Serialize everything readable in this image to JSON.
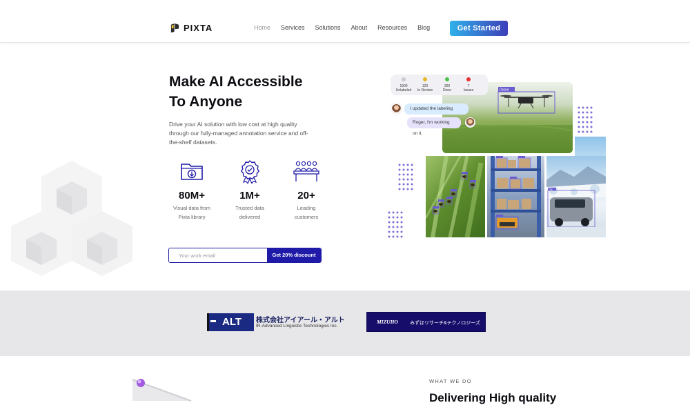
{
  "header": {
    "logo_text": "PIXTA",
    "nav": [
      {
        "label": "Home",
        "active": true
      },
      {
        "label": "Services",
        "active": false
      },
      {
        "label": "Solutions",
        "active": false
      },
      {
        "label": "About",
        "active": false
      },
      {
        "label": "Resources",
        "active": false
      },
      {
        "label": "Blog",
        "active": false
      }
    ],
    "cta_label": "Get Started"
  },
  "hero": {
    "title_line1": "Make AI Accessible",
    "title_line2": "To Anyone",
    "description": "Drive your AI solution with low cost at high quality through our fully-managed annotation service and off-the-shelf datasets.",
    "stats": [
      {
        "value": "80M+",
        "label_line1": "Visual data from",
        "label_line2": "Pixta library",
        "icon": "folder-download-icon"
      },
      {
        "value": "1M+",
        "label_line1": "Trusted data",
        "label_line2": "delivered",
        "icon": "award-badge-icon"
      },
      {
        "value": "20+",
        "label_line1": "Leading",
        "label_line2": "customers",
        "icon": "team-meeting-icon"
      }
    ],
    "email_placeholder": "Your work email",
    "discount_button": "Get 20% discount"
  },
  "collage": {
    "status": [
      {
        "count": "1500",
        "label": "Unlabeled",
        "color": "#c9c9cf"
      },
      {
        "count": "120",
        "label": "In Review",
        "color": "#e6b825"
      },
      {
        "count": "320",
        "label": "Done",
        "color": "#4cc24c"
      },
      {
        "count": "7",
        "label": "Issues",
        "color": "#e53232"
      }
    ],
    "chat": [
      {
        "text": "I updated the labeling guide."
      },
      {
        "text": "Roger, I'm working on it."
      }
    ],
    "drone_tag": "Drone",
    "car_tag": "Car"
  },
  "partners": {
    "alt_box": "ALT",
    "alt_jp": "株式会社アイアール・アルト",
    "alt_en": "IR-Advanced Linguistic Technologies Inc.",
    "mizuho_mark": "MIZUHO",
    "mizuho_text": "みずほリサーチ&テクノロジーズ"
  },
  "section": {
    "label": "WHAT WE DO",
    "heading": "Delivering High quality"
  },
  "colors": {
    "brand_blue": "#1f1aa8",
    "cta_gradient_start": "#2fb1ea",
    "cta_gradient_end": "#3d3fb9",
    "accent_purple": "#6b5bd0"
  }
}
